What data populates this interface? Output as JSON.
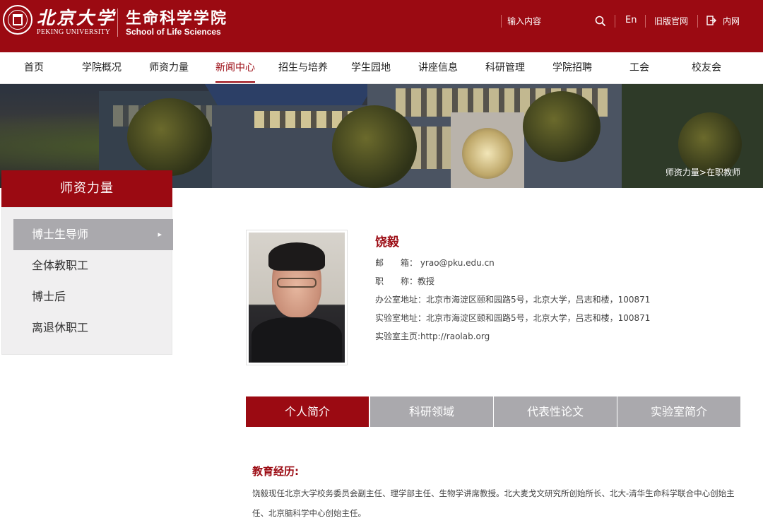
{
  "header": {
    "university_cn": "北京大学",
    "university_en": "PEKING UNIVERSITY",
    "school_cn": "生命科学学院",
    "school_en": "School of Life Sciences",
    "search_placeholder": "输入内容",
    "lang_link": "En",
    "old_site_link": "旧版官网",
    "intranet_link": "内网",
    "brand_color": "#9b0a12"
  },
  "nav": {
    "items": [
      "首页",
      "学院概况",
      "师资力量",
      "新闻中心",
      "招生与培养",
      "学生园地",
      "讲座信息",
      "科研管理",
      "学院招聘",
      "工会",
      "校友会"
    ],
    "active": "新闻中心"
  },
  "breadcrumb": [
    "师资力量",
    "在职教师"
  ],
  "sidebar": {
    "title": "师资力量",
    "items": [
      "博士生导师",
      "全体教职工",
      "博士后",
      "离退休职工"
    ],
    "active": "博士生导师"
  },
  "profile": {
    "name": "饶毅",
    "email": "邮　　箱： yrao@pku.edu.cn",
    "title": "职　　称：教授",
    "office": "办公室地址：北京市海淀区颐和园路5号，北京大学，吕志和楼，100871",
    "lab": "实验室地址：北京市海淀区颐和园路5号，北京大学，吕志和楼，100871",
    "homepage": "实验室主页:http://raolab.org"
  },
  "tabs": {
    "items": [
      "个人简介",
      "科研领域",
      "代表性论文",
      "实验室简介"
    ],
    "active": "个人简介"
  },
  "intro": {
    "heading": "教育经历:",
    "text": "饶毅现任北京大学校务委员会副主任、理学部主任、生物学讲席教授。北大麦戈文研究所创始所长、北大-清华生命科学联合中心创始主任、北京脑科学中心创始主任。"
  }
}
